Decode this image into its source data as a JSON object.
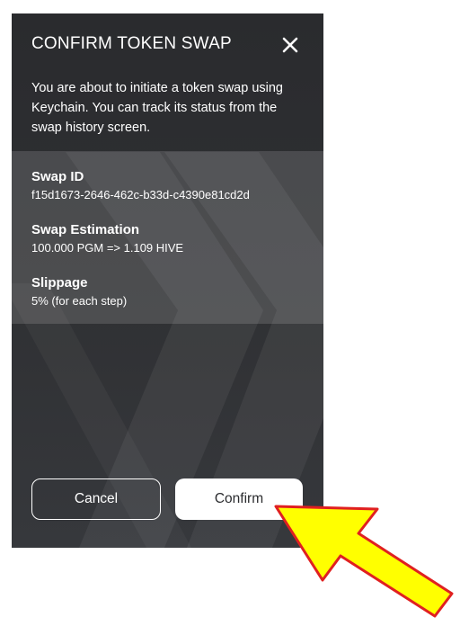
{
  "dialog": {
    "title": "CONFIRM TOKEN SWAP",
    "close_icon": "close-icon",
    "intro": "You are about to initiate a token swap using Keychain. You can track its status from the swap history screen.",
    "fields": [
      {
        "label": "Swap ID",
        "value": "f15d1673-2646-462c-b33d-c4390e81cd2d"
      },
      {
        "label": "Swap Estimation",
        "value": "100.000 PGM => 1.109 HIVE"
      },
      {
        "label": "Slippage",
        "value": "5% (for each step)"
      }
    ],
    "buttons": {
      "cancel": "Cancel",
      "confirm": "Confirm"
    }
  },
  "colors": {
    "panel_background": "#2f3033",
    "arrow_fill": "#ffff00",
    "arrow_outline": "#e02020"
  },
  "annotation": {
    "icon": "pointer-arrow-icon"
  }
}
